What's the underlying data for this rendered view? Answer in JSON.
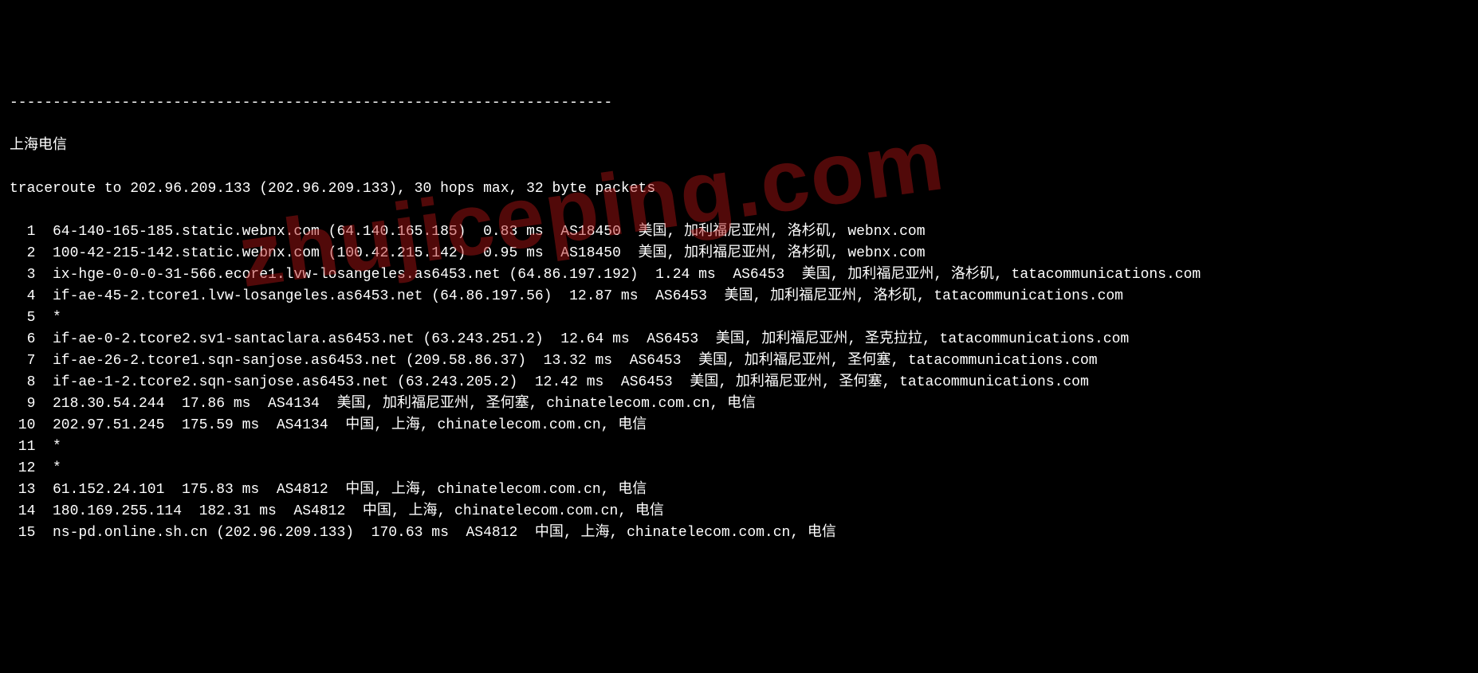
{
  "separator": "----------------------------------------------------------------------",
  "title": "上海电信",
  "command": "traceroute to 202.96.209.133 (202.96.209.133), 30 hops max, 32 byte packets",
  "watermark": "zhujiceping.com",
  "hops": [
    {
      "num": "1",
      "line": "64-140-165-185.static.webnx.com (64.140.165.185)  0.83 ms  AS18450  美国, 加利福尼亚州, 洛杉矶, webnx.com"
    },
    {
      "num": "2",
      "line": "100-42-215-142.static.webnx.com (100.42.215.142)  0.95 ms  AS18450  美国, 加利福尼亚州, 洛杉矶, webnx.com"
    },
    {
      "num": "3",
      "line": "ix-hge-0-0-0-31-566.ecore1.lvw-losangeles.as6453.net (64.86.197.192)  1.24 ms  AS6453  美国, 加利福尼亚州, 洛杉矶, tatacommunications.com"
    },
    {
      "num": "4",
      "line": "if-ae-45-2.tcore1.lvw-losangeles.as6453.net (64.86.197.56)  12.87 ms  AS6453  美国, 加利福尼亚州, 洛杉矶, tatacommunications.com"
    },
    {
      "num": "5",
      "line": "*"
    },
    {
      "num": "6",
      "line": "if-ae-0-2.tcore2.sv1-santaclara.as6453.net (63.243.251.2)  12.64 ms  AS6453  美国, 加利福尼亚州, 圣克拉拉, tatacommunications.com"
    },
    {
      "num": "7",
      "line": "if-ae-26-2.tcore1.sqn-sanjose.as6453.net (209.58.86.37)  13.32 ms  AS6453  美国, 加利福尼亚州, 圣何塞, tatacommunications.com"
    },
    {
      "num": "8",
      "line": "if-ae-1-2.tcore2.sqn-sanjose.as6453.net (63.243.205.2)  12.42 ms  AS6453  美国, 加利福尼亚州, 圣何塞, tatacommunications.com"
    },
    {
      "num": "9",
      "line": "218.30.54.244  17.86 ms  AS4134  美国, 加利福尼亚州, 圣何塞, chinatelecom.com.cn, 电信"
    },
    {
      "num": "10",
      "line": "202.97.51.245  175.59 ms  AS4134  中国, 上海, chinatelecom.com.cn, 电信"
    },
    {
      "num": "11",
      "line": "*"
    },
    {
      "num": "12",
      "line": "*"
    },
    {
      "num": "13",
      "line": "61.152.24.101  175.83 ms  AS4812  中国, 上海, chinatelecom.com.cn, 电信"
    },
    {
      "num": "14",
      "line": "180.169.255.114  182.31 ms  AS4812  中国, 上海, chinatelecom.com.cn, 电信"
    },
    {
      "num": "15",
      "line": "ns-pd.online.sh.cn (202.96.209.133)  170.63 ms  AS4812  中国, 上海, chinatelecom.com.cn, 电信"
    }
  ]
}
